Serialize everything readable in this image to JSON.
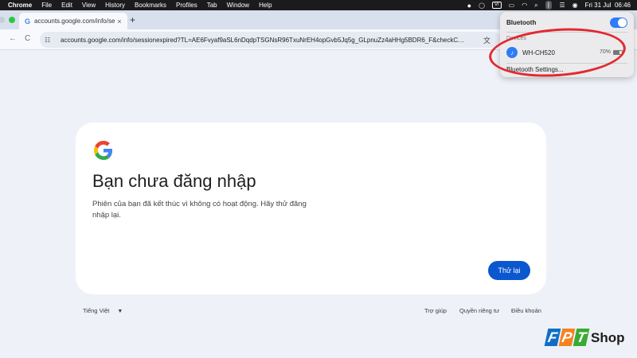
{
  "menubar": {
    "app": "Chrome",
    "items": [
      "File",
      "Edit",
      "View",
      "History",
      "Bookmarks",
      "Profiles",
      "Tab",
      "Window",
      "Help"
    ],
    "input_source": "VI",
    "datetime": "Fri 31 Jul  06:46"
  },
  "tab": {
    "title": "accounts.google.com/info/se",
    "close": "×",
    "new_tab": "+"
  },
  "toolbar": {
    "back": "←",
    "reload": "C",
    "url": "accounts.google.com/info/sessionexpired?TL=AE6Fvyaf9aSL6nDqdpTSGNsR96TxuNrEH4opGvb5Jq5g_GLpnuZz4aHHg5BDR6_F&checkC…"
  },
  "bluetooth": {
    "title": "Bluetooth",
    "enabled": true,
    "devices_label": "Devices",
    "device_name": "WH-CH520",
    "battery": "70%",
    "battery_level": 0.7,
    "settings": "Bluetooth Settings..."
  },
  "card": {
    "heading": "Bạn chưa đăng nhập",
    "message": "Phiên của bạn đã kết thúc vì không có hoạt động. Hãy thử đăng nhập lại.",
    "retry_button": "Thử lại"
  },
  "footer": {
    "language": "Tiếng Việt",
    "links": [
      "Trợ giúp",
      "Quyền riêng tư",
      "Điều khoản"
    ]
  },
  "watermark": {
    "letters": [
      "F",
      "P",
      "T"
    ],
    "shop": "Shop"
  },
  "colors": {
    "accent_blue": "#0b57d0",
    "annotation_red": "#e2292f",
    "bt_blue": "#2f7cf6",
    "fpt_blue": "#0f6fc6",
    "fpt_orange": "#f5821f",
    "fpt_green": "#3aaa35"
  }
}
